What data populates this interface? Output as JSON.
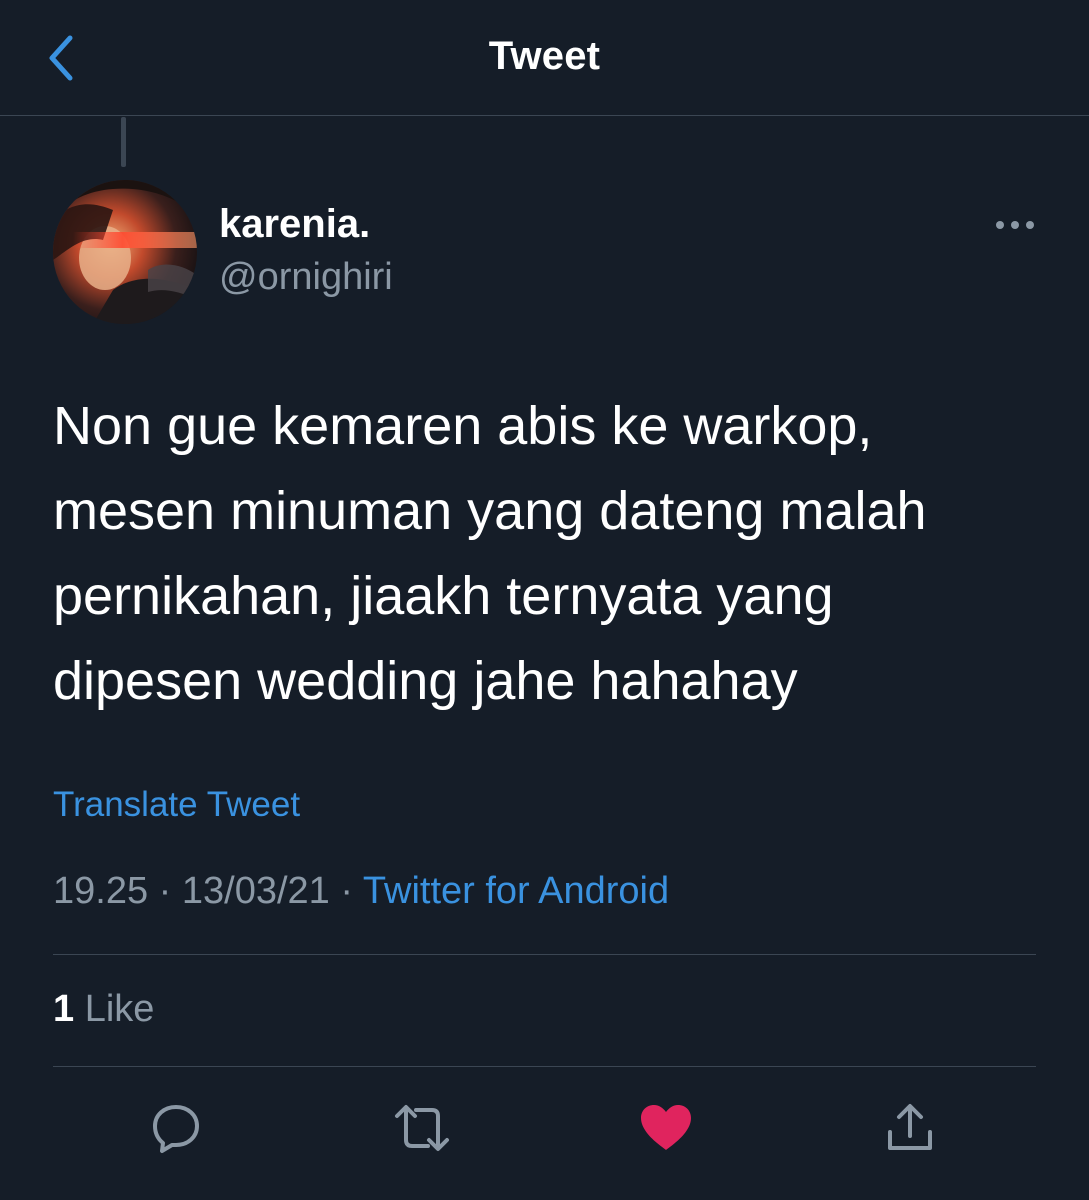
{
  "header": {
    "title": "Tweet",
    "back_icon": "chevron-left-icon"
  },
  "tweet": {
    "author": {
      "display_name": "karenia.",
      "handle": "@ornighiri"
    },
    "text": "Non gue kemaren abis ke warkop,\nmesen minuman yang dateng malah\npernikahan, jiaakh ternyata yang\ndipesen wedding jahe hahahay",
    "translate_label": "Translate Tweet",
    "time": "19.25",
    "separator": "·",
    "date": "13/03/21",
    "source": "Twitter for Android",
    "like_count": "1",
    "like_label": "Like"
  },
  "actions": {
    "reply_icon": "reply-icon",
    "retweet_icon": "retweet-icon",
    "like_icon": "heart-icon",
    "share_icon": "share-icon"
  },
  "colors": {
    "background": "#151d28",
    "accent": "#3a92e0",
    "muted": "#8b98a5",
    "divider": "#3b4653",
    "like": "#e0245e"
  }
}
